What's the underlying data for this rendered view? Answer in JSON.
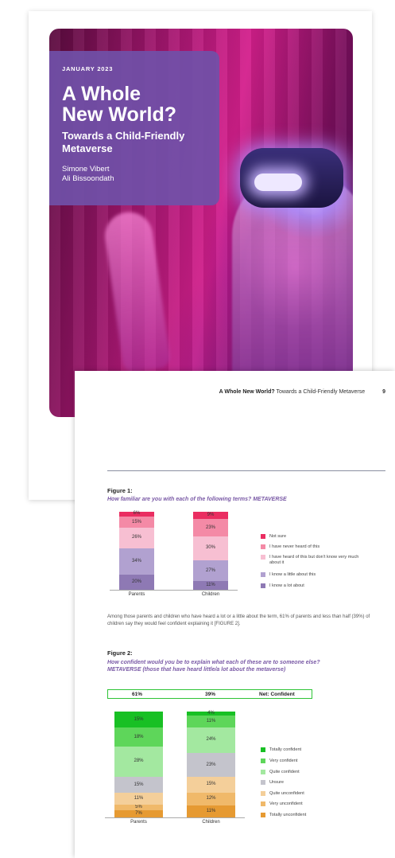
{
  "cover": {
    "date": "JANUARY 2023",
    "title_line1": "A Whole",
    "title_line2": "New World?",
    "subtitle_line1": "Towards a Child-Friendly",
    "subtitle_line2": "Metaverse",
    "author1": "Simone Vibert",
    "author2": "Ali Bissoondath"
  },
  "page": {
    "running_title_bold": "A Whole New World?",
    "running_title_rest": "Towards a Child-Friendly Metaverse",
    "page_number": "9",
    "body_text": "Among those parents and children who have heard a lot or a little about the term, 61% of parents and less than half (39%) of children say they would feel confident explaining it [FIGURE 2]."
  },
  "figure1": {
    "label": "Figure 1:",
    "question": "How familiar are you with each of the following terms? METAVERSE"
  },
  "figure2": {
    "label": "Figure 2:",
    "question_line1": "How confident would you be to explain what each of these are to someone else?",
    "question_line2": "METAVERSE (those that have heard  little/a lot about the metaverse)",
    "net_parents": "61%",
    "net_children": "39%",
    "net_label": "Net: Confident"
  },
  "chart_data": [
    {
      "type": "bar",
      "stacked": true,
      "categories": [
        "Parents",
        "Children"
      ],
      "series": [
        {
          "name": "I know a lot about",
          "values": [
            20,
            11
          ],
          "labels": [
            "20%",
            "11%"
          ],
          "color": "#8e79b4"
        },
        {
          "name": "I know a little about this",
          "values": [
            34,
            27
          ],
          "labels": [
            "34%",
            "27%"
          ],
          "color": "#b1a1d0"
        },
        {
          "name": "I have heard of this but don't know very much about it",
          "values": [
            26,
            30
          ],
          "labels": [
            "26%",
            "30%"
          ],
          "color": "#f7bfd2"
        },
        {
          "name": "I have never heard of this",
          "values": [
            15,
            23
          ],
          "labels": [
            "15%",
            "23%"
          ],
          "color": "#f48aa6"
        },
        {
          "name": "Not sure",
          "values": [
            6,
            9
          ],
          "labels": [
            "6%",
            "9%"
          ],
          "color": "#ea2d61"
        }
      ],
      "legend_position": "right"
    },
    {
      "type": "bar",
      "stacked": true,
      "categories": [
        "Parents",
        "Children"
      ],
      "series": [
        {
          "name": "Totally unconfident",
          "values": [
            7,
            11
          ],
          "labels": [
            "7%",
            "11%"
          ],
          "color": "#e69a32"
        },
        {
          "name": "Very unconfident",
          "values": [
            5,
            12
          ],
          "labels": [
            "5%",
            "12%"
          ],
          "color": "#f0b96a"
        },
        {
          "name": "Quite unconfident",
          "values": [
            11,
            15
          ],
          "labels": [
            "11%",
            "15%"
          ],
          "color": "#f4cf9a"
        },
        {
          "name": "Unsure",
          "values": [
            15,
            23
          ],
          "labels": [
            "15%",
            "23%"
          ],
          "color": "#c4c4cc"
        },
        {
          "name": "Quite confident",
          "values": [
            28,
            24
          ],
          "labels": [
            "28%",
            "24%"
          ],
          "color": "#a3e8a0"
        },
        {
          "name": "Very confident",
          "values": [
            18,
            11
          ],
          "labels": [
            "18%",
            "11%"
          ],
          "color": "#5ed65a"
        },
        {
          "name": "Totally confident",
          "values": [
            15,
            4
          ],
          "labels": [
            "15%",
            "4%"
          ],
          "color": "#18c024"
        }
      ],
      "legend_position": "right"
    }
  ]
}
